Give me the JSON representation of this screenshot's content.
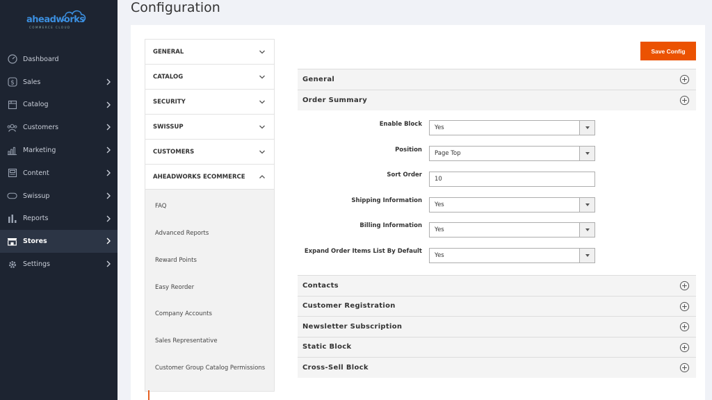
{
  "brand": {
    "name": "aheadworks",
    "tagline": "COMMERCE CLOUD"
  },
  "sidebar": {
    "items": [
      {
        "label": "Dashboard",
        "icon": "speedometer-icon",
        "chevron": false,
        "active": false
      },
      {
        "label": "Sales",
        "icon": "dollar-icon",
        "chevron": true,
        "active": false
      },
      {
        "label": "Catalog",
        "icon": "box-icon",
        "chevron": true,
        "active": false
      },
      {
        "label": "Customers",
        "icon": "users-icon",
        "chevron": true,
        "active": false
      },
      {
        "label": "Marketing",
        "icon": "bar-chart-icon",
        "chevron": true,
        "active": false
      },
      {
        "label": "Content",
        "icon": "layout-icon",
        "chevron": true,
        "active": false
      },
      {
        "label": "Swissup",
        "icon": "toggle-icon",
        "chevron": true,
        "active": false
      },
      {
        "label": "Reports",
        "icon": "reports-icon",
        "chevron": true,
        "active": false
      },
      {
        "label": "Stores",
        "icon": "store-icon",
        "chevron": true,
        "active": true
      },
      {
        "label": "Settings",
        "icon": "gear-icon",
        "chevron": true,
        "active": false
      }
    ]
  },
  "page": {
    "title": "Configuration"
  },
  "tree": {
    "sections": [
      {
        "label": "GENERAL",
        "expanded": false
      },
      {
        "label": "CATALOG",
        "expanded": false
      },
      {
        "label": "SECURITY",
        "expanded": false
      },
      {
        "label": "SWISSUP",
        "expanded": false
      },
      {
        "label": "CUSTOMERS",
        "expanded": false
      },
      {
        "label": "AHEADWORKS ECOMMERCE",
        "expanded": true
      }
    ],
    "subitems": [
      "FAQ",
      "Advanced Reports",
      "Reward Points",
      "Easy Reorder",
      "Company Accounts",
      "Sales Representative",
      "Customer Group Catalog Permissions"
    ]
  },
  "toolbar": {
    "save_label": "Save Config"
  },
  "groups": {
    "general": "General",
    "order_summary": "Order Summary",
    "contacts": "Contacts",
    "customer_registration": "Customer Registration",
    "newsletter_subscription": "Newsletter Subscription",
    "static_block": "Static Block",
    "cross_sell_block": "Cross-Sell Block"
  },
  "order_summary": {
    "fields": [
      {
        "label": "Enable Block",
        "type": "select",
        "value": "Yes"
      },
      {
        "label": "Position",
        "type": "select",
        "value": "Page Top"
      },
      {
        "label": "Sort Order",
        "type": "input",
        "value": "10"
      },
      {
        "label": "Shipping Information",
        "type": "select",
        "value": "Yes"
      },
      {
        "label": "Billing Information",
        "type": "select",
        "value": "Yes"
      },
      {
        "label": "Expand Order Items List By Default",
        "type": "select",
        "value": "Yes"
      }
    ]
  },
  "colors": {
    "accent": "#eb5202",
    "sidebar_bg": "#1d2431",
    "brand_blue": "#3b8fe0"
  }
}
